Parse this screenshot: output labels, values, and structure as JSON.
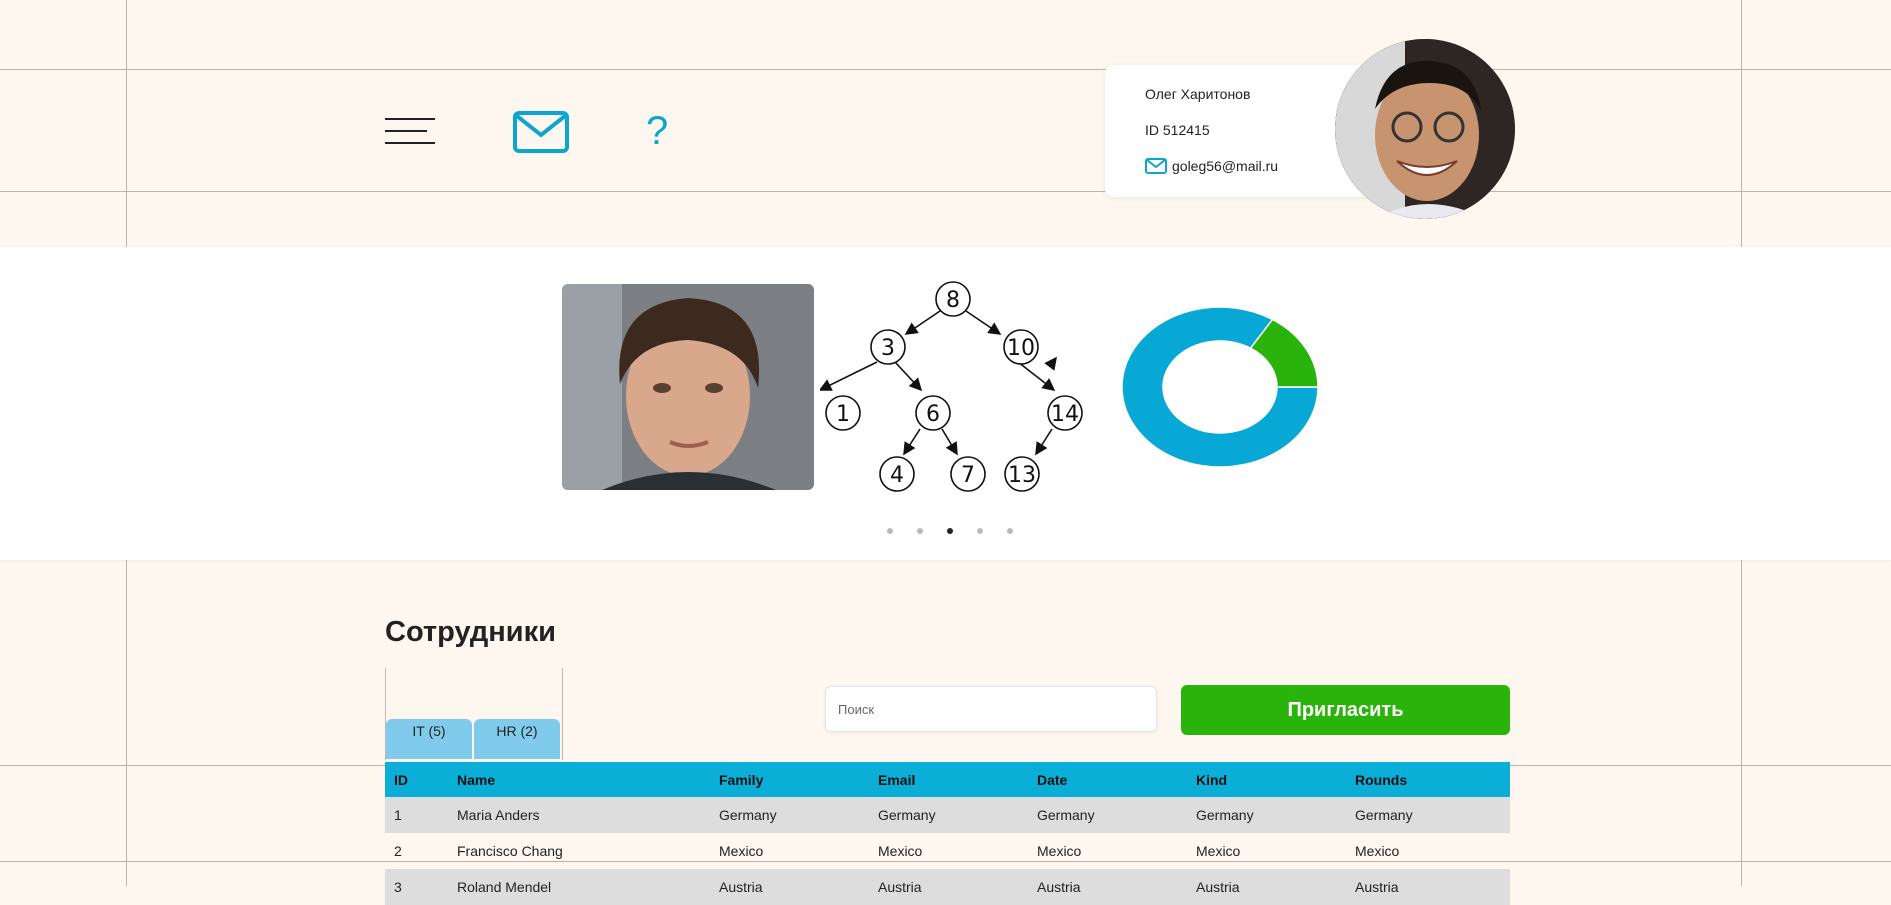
{
  "header": {
    "menu_icon": "hamburger-icon",
    "mail_icon": "mail-icon",
    "help_label": "?"
  },
  "user": {
    "name": "Олег Харитонов",
    "id_label": "ID 512415",
    "email": "goleg56@mail.ru"
  },
  "carousel": {
    "tree_nodes": [
      "8",
      "3",
      "10",
      "1",
      "6",
      "14",
      "4",
      "7",
      "13"
    ],
    "donut": {
      "type": "pie",
      "values": [
        84,
        16
      ],
      "colors": [
        "#07a7d6",
        "#2ab40b"
      ]
    },
    "active_slide": 3,
    "slide_count": 5
  },
  "employees": {
    "title": "Сотрудники",
    "tabs": [
      {
        "label": "IT (5)"
      },
      {
        "label": "HR (2)"
      }
    ],
    "search_placeholder": "Поиск",
    "invite_label": "Пригласить",
    "columns": [
      "ID",
      "Name",
      "Family",
      "Email",
      "Date",
      "Kind",
      "Rounds"
    ],
    "rows": [
      [
        "1",
        "Maria Anders",
        "Germany",
        "Germany",
        "Germany",
        "Germany",
        "Germany"
      ],
      [
        "2",
        "Francisco Chang",
        "Mexico",
        "Mexico",
        "Mexico",
        "Mexico",
        "Mexico"
      ],
      [
        "3",
        "Roland Mendel",
        "Austria",
        "Austria",
        "Austria",
        "Austria",
        "Austria"
      ]
    ]
  },
  "colors": {
    "accent": "#0aaed6",
    "invite": "#2ab40b",
    "tab": "#80cbec",
    "background": "#fdf7f0"
  }
}
